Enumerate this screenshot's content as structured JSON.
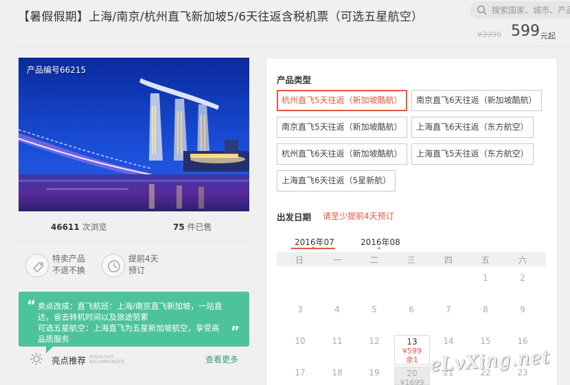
{
  "header": {
    "title": "【暑假假期】上海/南京/杭州直飞新加坡5/6天往返含税机票（可选五星航空）",
    "search_placeholder": "搜索国家、城市、产品",
    "price_old": "¥3999",
    "price_now": "599",
    "price_unit": "元起"
  },
  "product": {
    "code_label": "产品编号66215",
    "views_count": "46611",
    "views_label": "次浏览",
    "sold_count": "75",
    "sold_label": "件已售",
    "features": [
      {
        "icon": "tag-icon",
        "line1": "特卖产品",
        "line2": "不退不换"
      },
      {
        "icon": "clock-icon",
        "line1": "提前4天",
        "line2": "预订"
      }
    ],
    "selling_points": {
      "line1": "卖点改成：直飞航班：上海/南京直飞新加坡，一站直",
      "line2": "达，省去转机时间以及旅途劳累",
      "line3": "可选五星航空：上海直飞为五星新加坡航空，享受高",
      "line4": "品质服务"
    },
    "highlight_label": "亮点推荐",
    "highlight_en_1": "HIGHLIGHT",
    "highlight_en_2": "RECOMMENDED",
    "see_more": "查看更多"
  },
  "panel": {
    "type_title": "产品类型",
    "options": [
      {
        "label": "杭州直飞5天往返（新加坡酷航）",
        "selected": true
      },
      {
        "label": "南京直飞6天往返（新加坡酷航）",
        "selected": false
      },
      {
        "label": "南京直飞5天往返（新加坡酷航）",
        "selected": false
      },
      {
        "label": "上海直飞6天往返（东方航空）",
        "selected": false
      },
      {
        "label": "杭州直飞6天往返（新加坡酷航）",
        "selected": false
      },
      {
        "label": "上海直飞5天往返（东方航空）",
        "selected": false
      },
      {
        "label": "上海直飞6天往返（5星新航）",
        "selected": false
      }
    ],
    "date_title": "出发日期",
    "date_hint": "请至少提前4天预订",
    "months": [
      "2016年07",
      "2016年08"
    ],
    "weekdays": [
      "日",
      "一",
      "二",
      "三",
      "四",
      "五",
      "六"
    ],
    "days": {
      "d1": "1",
      "d2": "2",
      "d3": "3",
      "d4": "4",
      "d5": "5",
      "d6": "6",
      "d7": "7",
      "d8": "8",
      "d9": "9",
      "d10": "10",
      "d11": "11",
      "d12": "12",
      "d13": "13",
      "d14": "14",
      "d15": "15",
      "d16": "16",
      "d17": "17",
      "d18": "18",
      "d19": "19",
      "d20": "20",
      "d21": "21",
      "d22": "22",
      "d23": "23"
    },
    "day13_price": "¥599",
    "day13_stock": "余1",
    "day20_price": "¥1699"
  },
  "watermark": "eLvXing.net",
  "colors": {
    "accent": "#e8553e",
    "green": "#4dc39c",
    "link_green": "#3aa07c"
  }
}
